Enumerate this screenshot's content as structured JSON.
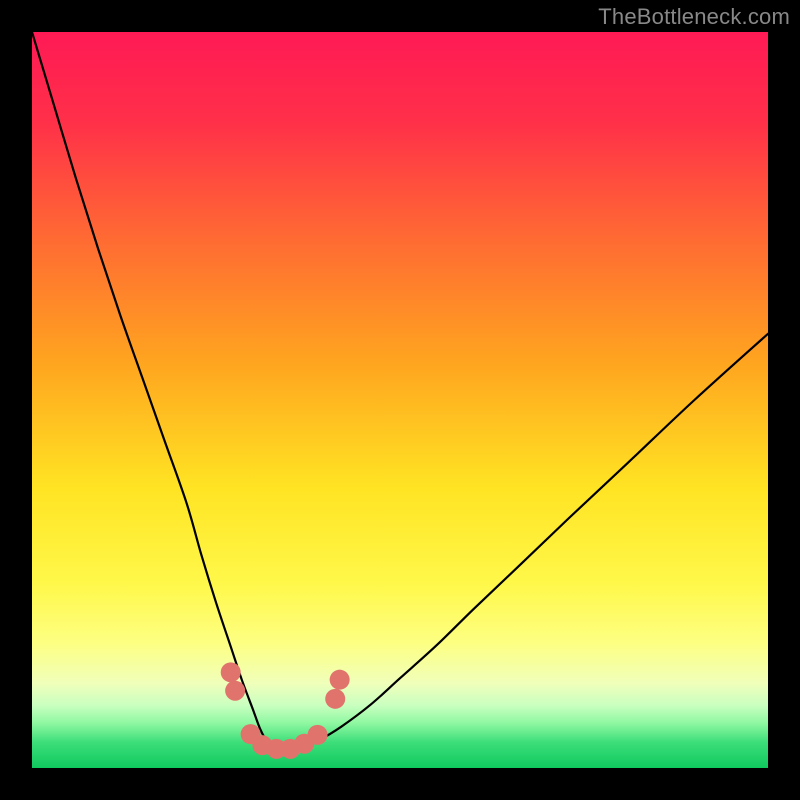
{
  "watermark": "TheBottleneck.com",
  "chart_data": {
    "type": "line",
    "title": "",
    "xlabel": "",
    "ylabel": "",
    "xlim": [
      0,
      100
    ],
    "ylim": [
      0,
      100
    ],
    "background_gradient": {
      "stops": [
        {
          "offset": 0.0,
          "color": "#ff1a55"
        },
        {
          "offset": 0.12,
          "color": "#ff2f49"
        },
        {
          "offset": 0.28,
          "color": "#ff6a33"
        },
        {
          "offset": 0.45,
          "color": "#ffa51f"
        },
        {
          "offset": 0.62,
          "color": "#ffe423"
        },
        {
          "offset": 0.75,
          "color": "#fff84a"
        },
        {
          "offset": 0.83,
          "color": "#fdff82"
        },
        {
          "offset": 0.885,
          "color": "#f0ffba"
        },
        {
          "offset": 0.915,
          "color": "#c9ffc0"
        },
        {
          "offset": 0.94,
          "color": "#8cf7a0"
        },
        {
          "offset": 0.965,
          "color": "#3dde7a"
        },
        {
          "offset": 1.0,
          "color": "#0fc95e"
        }
      ]
    },
    "series": [
      {
        "name": "bottleneck-curve",
        "color": "#000000",
        "width": 2.2,
        "x": [
          0,
          3,
          6,
          9,
          12,
          15,
          18,
          21,
          23,
          25,
          27,
          28.5,
          30,
          31,
          32,
          33,
          34.5,
          36.5,
          39,
          42,
          46,
          50,
          55,
          60,
          66,
          73,
          81,
          90,
          100
        ],
        "y": [
          100,
          90,
          80,
          70.5,
          61.5,
          53,
          44.5,
          36,
          29,
          22.5,
          16.5,
          12,
          8,
          5.3,
          3.5,
          2.6,
          2.4,
          2.8,
          3.8,
          5.6,
          8.6,
          12.2,
          16.7,
          21.6,
          27.3,
          34,
          41.5,
          50,
          59
        ]
      }
    ],
    "markers": {
      "name": "datapoints",
      "color": "#e0746d",
      "radius": 10,
      "points": [
        {
          "x": 27.0,
          "y": 13.0
        },
        {
          "x": 27.6,
          "y": 10.5
        },
        {
          "x": 29.7,
          "y": 4.6
        },
        {
          "x": 31.3,
          "y": 3.1
        },
        {
          "x": 33.2,
          "y": 2.6
        },
        {
          "x": 35.1,
          "y": 2.6
        },
        {
          "x": 37.0,
          "y": 3.3
        },
        {
          "x": 38.8,
          "y": 4.5
        },
        {
          "x": 41.2,
          "y": 9.4
        },
        {
          "x": 41.8,
          "y": 12.0
        }
      ]
    }
  }
}
